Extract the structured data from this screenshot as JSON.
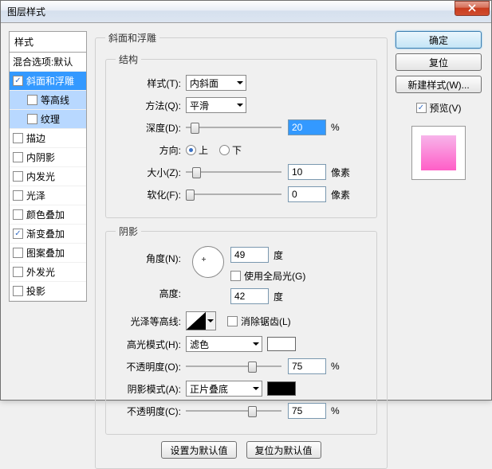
{
  "window": {
    "title": "图层样式"
  },
  "left": {
    "header": "样式",
    "blend": "混合选项:默认",
    "items": [
      {
        "label": "斜面和浮雕",
        "checked": true,
        "selected": true
      },
      {
        "label": "等高线",
        "checked": false,
        "indent": true,
        "highlight": true
      },
      {
        "label": "纹理",
        "checked": false,
        "indent": true,
        "highlight": true
      },
      {
        "label": "描边",
        "checked": false
      },
      {
        "label": "内阴影",
        "checked": false
      },
      {
        "label": "内发光",
        "checked": false
      },
      {
        "label": "光泽",
        "checked": false
      },
      {
        "label": "颜色叠加",
        "checked": false
      },
      {
        "label": "渐变叠加",
        "checked": true
      },
      {
        "label": "图案叠加",
        "checked": false
      },
      {
        "label": "外发光",
        "checked": false
      },
      {
        "label": "投影",
        "checked": false
      }
    ]
  },
  "bevel": {
    "group": "斜面和浮雕",
    "structure": {
      "legend": "结构",
      "style_lbl": "样式(T):",
      "style_val": "内斜面",
      "method_lbl": "方法(Q):",
      "method_val": "平滑",
      "depth_lbl": "深度(D):",
      "depth_val": "20",
      "depth_unit": "%",
      "dir_lbl": "方向:",
      "up": "上",
      "down": "下",
      "size_lbl": "大小(Z):",
      "size_val": "10",
      "size_unit": "像素",
      "soften_lbl": "软化(F):",
      "soften_val": "0",
      "soften_unit": "像素"
    },
    "shading": {
      "legend": "阴影",
      "angle_lbl": "角度(N):",
      "angle_val": "49",
      "angle_unit": "度",
      "global_lbl": "使用全局光(G)",
      "alt_lbl": "高度:",
      "alt_val": "42",
      "alt_unit": "度",
      "contour_lbl": "光泽等高线:",
      "aa_lbl": "消除锯齿(L)",
      "hi_mode_lbl": "高光模式(H):",
      "hi_mode_val": "滤色",
      "opacity1_lbl": "不透明度(O):",
      "opacity1_val": "75",
      "opacity1_unit": "%",
      "sh_mode_lbl": "阴影模式(A):",
      "sh_mode_val": "正片叠底",
      "opacity2_lbl": "不透明度(C):",
      "opacity2_val": "75",
      "opacity2_unit": "%"
    },
    "buttons": {
      "default": "设置为默认值",
      "reset": "复位为默认值"
    }
  },
  "right": {
    "ok": "确定",
    "cancel": "复位",
    "new_style": "新建样式(W)...",
    "preview": "预览(V)"
  }
}
